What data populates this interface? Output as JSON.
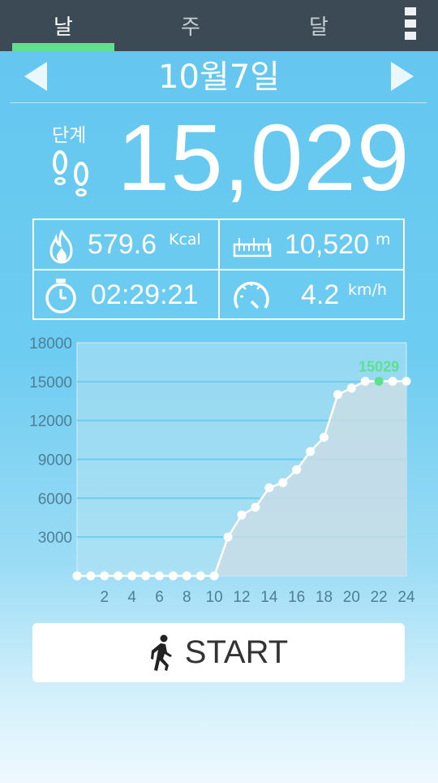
{
  "tabs": [
    {
      "label": "날",
      "active": true
    },
    {
      "label": "주",
      "active": false
    },
    {
      "label": "달",
      "active": false
    }
  ],
  "date": "10월7일",
  "steps": {
    "label": "단계",
    "value": "15,029"
  },
  "stats": {
    "calories": {
      "value": "579.6",
      "unit": "Kcal"
    },
    "distance": {
      "value": "10,520",
      "unit": "m"
    },
    "duration": {
      "value": "02:29:21"
    },
    "speed": {
      "value": "4.2",
      "unit": "km/h"
    }
  },
  "start_label": "START",
  "colors": {
    "highlight": "#5ee08f",
    "tabbar": "#3b4a55"
  },
  "chart_data": {
    "type": "area",
    "x": [
      0,
      1,
      2,
      3,
      4,
      5,
      6,
      7,
      8,
      9,
      10,
      11,
      12,
      13,
      14,
      15,
      16,
      17,
      18,
      19,
      20,
      21,
      22,
      23,
      24
    ],
    "values": [
      0,
      0,
      0,
      0,
      0,
      0,
      0,
      0,
      0,
      0,
      0,
      3000,
      4700,
      5300,
      6800,
      7200,
      8200,
      9600,
      10700,
      14000,
      14500,
      15029,
      15029,
      15029,
      15029
    ],
    "xticks": [
      "2",
      "4",
      "6",
      "8",
      "10",
      "12",
      "14",
      "16",
      "18",
      "20",
      "22",
      "24"
    ],
    "yticks": [
      "3000",
      "6000",
      "9000",
      "12000",
      "15000",
      "18000"
    ],
    "ylim": [
      0,
      18000
    ],
    "xlim": [
      0,
      24
    ],
    "annotation": {
      "x": 22,
      "label": "15029"
    },
    "grid": true
  }
}
